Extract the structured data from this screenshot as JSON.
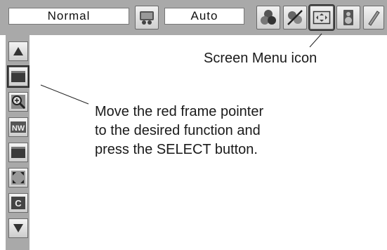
{
  "top_menu": {
    "mode_label": "Normal",
    "setting_label": "Auto",
    "icons": [
      "computer-adjust-icon",
      "image-adjust-icon",
      "color-icon",
      "screen-icon",
      "sound-icon",
      "setting-icon"
    ]
  },
  "side_menu": {
    "icons": [
      "up-arrow-icon",
      "normal-screen-icon",
      "zoom-icon",
      "natural-wide-icon",
      "full-icon",
      "custom-icon",
      "clear-icon",
      "down-arrow-icon"
    ]
  },
  "callouts": {
    "screen_menu_icon": "Screen Menu icon",
    "instruction_line1": "Move the red frame pointer",
    "instruction_line2": "to the desired function and",
    "instruction_line3": "press the SELECT button."
  }
}
